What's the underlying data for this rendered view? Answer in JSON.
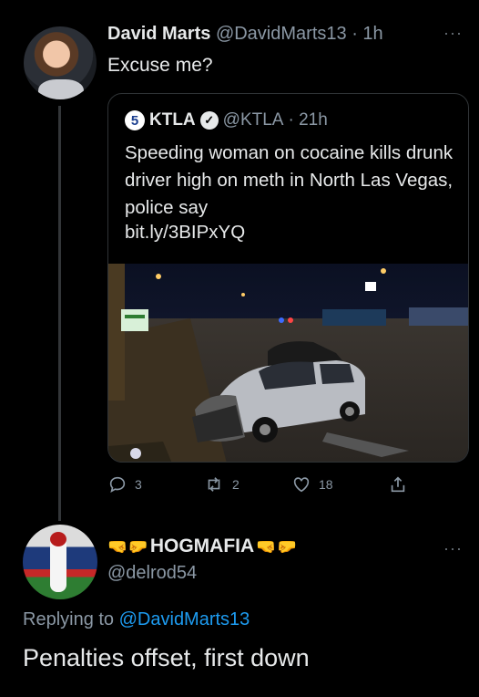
{
  "tweet1": {
    "author_name": "David Marts",
    "author_handle": "@DavidMarts13",
    "time": "· 1h",
    "more": "···",
    "text": "Excuse me?",
    "quote": {
      "logo": "5",
      "name": "KTLA",
      "verified_glyph": "✓",
      "handle": "@KTLA",
      "time": "· 21h",
      "text": "Speeding woman on cocaine kills drunk driver high on meth in North Las Vegas, police say",
      "link": "bit.ly/3BIPxYQ",
      "image_icon": "crash-scene-photo"
    },
    "actions": {
      "replies": "3",
      "retweets": "2",
      "likes": "18"
    }
  },
  "tweet2": {
    "author_name": "HOGMAFIA",
    "name_emoji": "fist-bump-emoji",
    "author_handle": "@delrod54",
    "more": "···",
    "replying_prefix": "Replying to",
    "replying_to": "@DavidMarts13",
    "text": "Penalties offset, first down"
  },
  "colors": {
    "background": "#000000",
    "text": "#e7e9ea",
    "secondary": "#8b98a5",
    "link": "#1d9bf0",
    "border": "#2f3336"
  }
}
